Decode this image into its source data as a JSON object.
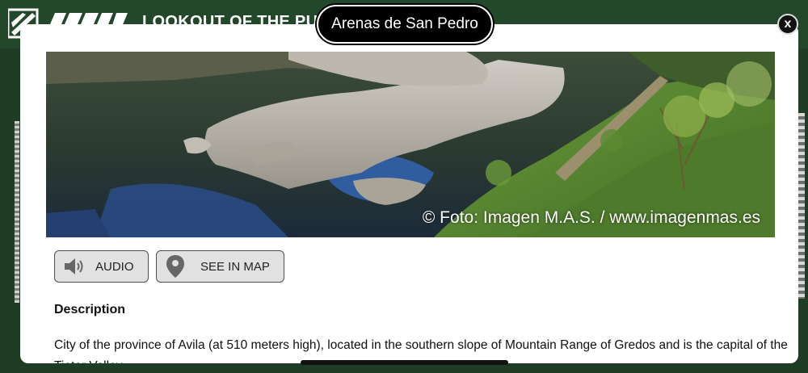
{
  "background": {
    "header_title": "LOOKOUT OF THE PU"
  },
  "modal": {
    "title": "Arenas de San Pedro",
    "close_label": "x",
    "photo": {
      "watermark": "© Foto: Imagen M.A.S. / www.imagenmas.es"
    },
    "buttons": {
      "audio_label": "AUDIO",
      "map_label": "SEE IN MAP"
    },
    "description_heading": "Description",
    "description_text": "City of the province of Avila (at 510 meters high), located in the southern slope of Mountain Range of Gredos and is the capital of the Tietar Valley."
  },
  "icons": {
    "audio": "speaker-icon",
    "map": "map-pin-icon",
    "close": "close-icon"
  },
  "colors": {
    "background_green": "#23472b",
    "button_bg": "#e1e1e1",
    "pill_bg": "#000000"
  }
}
